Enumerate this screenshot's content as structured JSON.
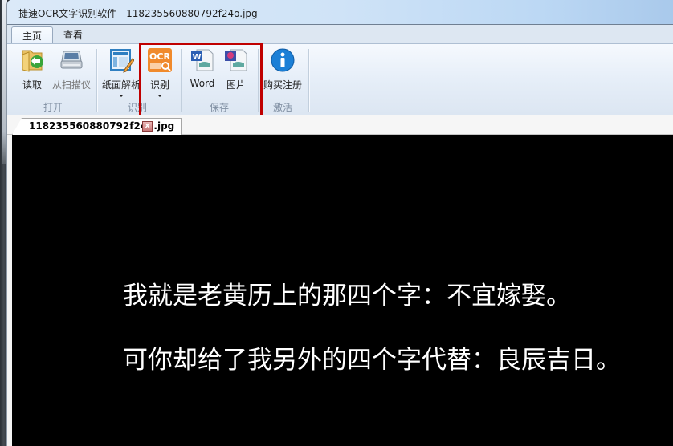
{
  "window": {
    "title": "捷速OCR文字识别软件 - 118235560880792f24o.jpg"
  },
  "ribbon_tabs": [
    {
      "label": "主页",
      "active": true
    },
    {
      "label": "查看",
      "active": false
    }
  ],
  "ribbon": {
    "groups": [
      {
        "label": "打开",
        "buttons": [
          {
            "label": "读取",
            "icon": "folder-open-icon"
          },
          {
            "label": "从扫描仪",
            "icon": "scanner-icon",
            "disabled": true
          }
        ]
      },
      {
        "label": "识别",
        "buttons": [
          {
            "label": "纸面解析",
            "icon": "page-layout-icon",
            "dropdown": true
          },
          {
            "label": "识别",
            "icon": "ocr-icon",
            "icon_text": "OCR",
            "dropdown": true
          }
        ]
      },
      {
        "label": "保存",
        "buttons": [
          {
            "label": "Word",
            "icon": "word-document-icon"
          },
          {
            "label": "图片",
            "icon": "image-file-icon"
          }
        ]
      },
      {
        "label": "激活",
        "buttons": [
          {
            "label": "购买注册",
            "icon": "info-icon"
          }
        ]
      }
    ]
  },
  "document": {
    "tab_label": "118235560880792f24o.jpg",
    "close_glyph": "x",
    "image_text": [
      "我就是老黄历上的那四个字：不宜嫁娶。",
      "可你却给了我另外的四个字代替：良辰吉日。"
    ]
  },
  "colors": {
    "highlight_box": "#c00000",
    "canvas_bg": "#000000",
    "ocr_orange": "#f08a2c",
    "info_blue": "#1b7fd6"
  }
}
